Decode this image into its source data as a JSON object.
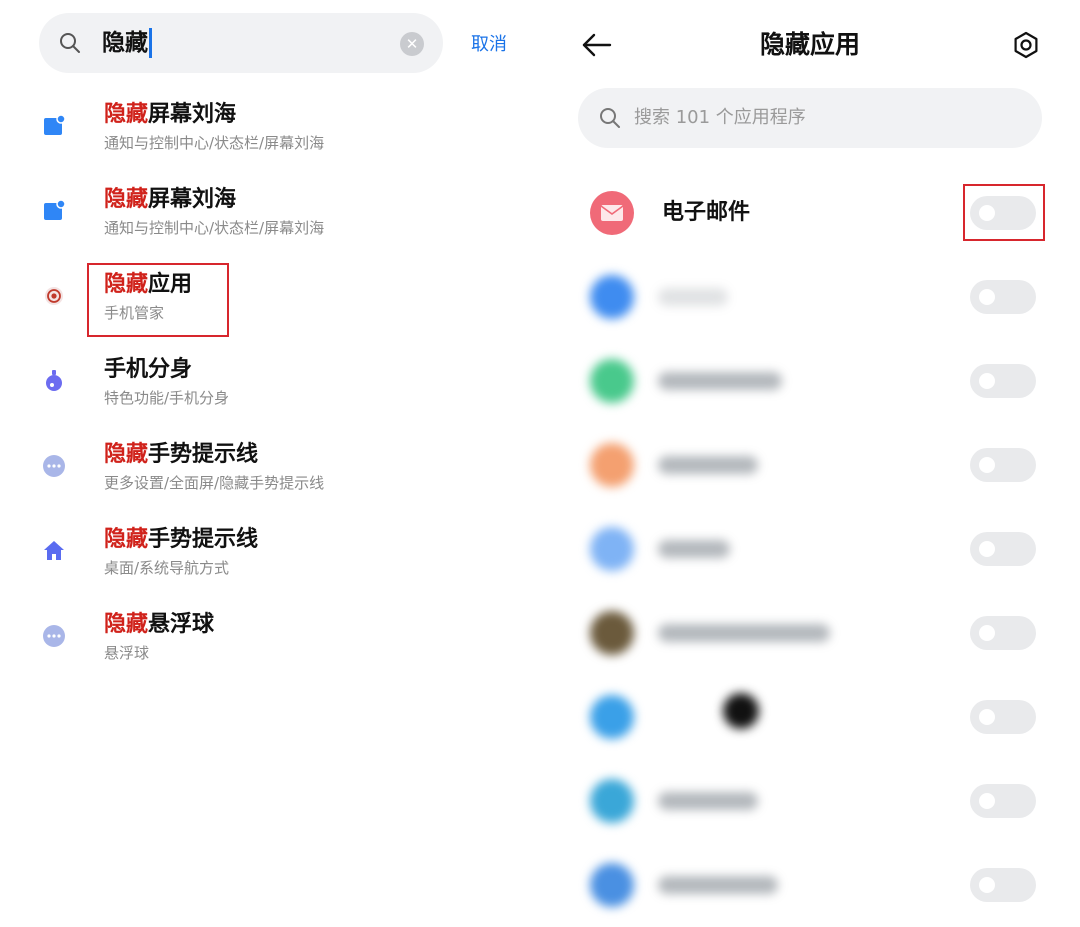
{
  "search": {
    "query": "隐藏",
    "cancel_label": "取消"
  },
  "results": [
    {
      "highlight": "隐藏",
      "rest": "屏幕刘海",
      "path": "通知与控制中心/状态栏/屏幕刘海",
      "icon": "notification-icon",
      "color": "#2f86f6"
    },
    {
      "highlight": "隐藏",
      "rest": "屏幕刘海",
      "path": "通知与控制中心/状态栏/屏幕刘海",
      "icon": "notification-icon",
      "color": "#2f86f6"
    },
    {
      "highlight": "隐藏",
      "rest": "应用",
      "path": "手机管家",
      "icon": "security-app-icon",
      "color": "#c0392b"
    },
    {
      "highlight": "",
      "rest": "手机分身",
      "path": "特色功能/手机分身",
      "icon": "second-space-icon",
      "color": "#6c6cf0"
    },
    {
      "highlight": "隐藏",
      "rest": "手势提示线",
      "path": "更多设置/全面屏/隐藏手势提示线",
      "icon": "more-settings-icon",
      "color": "#a9b6e8"
    },
    {
      "highlight": "隐藏",
      "rest": "手势提示线",
      "path": "桌面/系统导航方式",
      "icon": "home-icon",
      "color": "#5a6cf0"
    },
    {
      "highlight": "隐藏",
      "rest": "悬浮球",
      "path": "悬浮球",
      "icon": "more-settings-icon",
      "color": "#a9b6e8"
    }
  ],
  "hidden_apps": {
    "title": "隐藏应用",
    "search_placeholder": "搜索 101 个应用程序",
    "apps": [
      {
        "name": "电子邮件",
        "icon": "email-icon",
        "color": "#f06a78",
        "enabled": false
      },
      {
        "name": "",
        "icon": "blurred-app-icon",
        "color": "#3f8cf0",
        "enabled": false
      },
      {
        "name": "",
        "icon": "blurred-app-icon",
        "color": "#49c98c",
        "enabled": false
      },
      {
        "name": "",
        "icon": "blurred-app-icon",
        "color": "#f4a070",
        "enabled": false
      },
      {
        "name": "",
        "icon": "blurred-app-icon",
        "color": "#7fb3f5",
        "enabled": false
      },
      {
        "name": "",
        "icon": "blurred-app-icon",
        "color": "#6b5a3c",
        "enabled": false
      },
      {
        "name": "",
        "icon": "blurred-app-icon",
        "color": "#3aa0e8",
        "enabled": false
      },
      {
        "name": "",
        "icon": "blurred-app-icon",
        "color": "#3aa7d8",
        "enabled": false
      },
      {
        "name": "",
        "icon": "blurred-app-icon",
        "color": "#4a90e2",
        "enabled": false
      }
    ]
  },
  "colors": {
    "highlight": "#d0221b",
    "accent": "#1a73e8",
    "annotation": "#d7262d"
  }
}
